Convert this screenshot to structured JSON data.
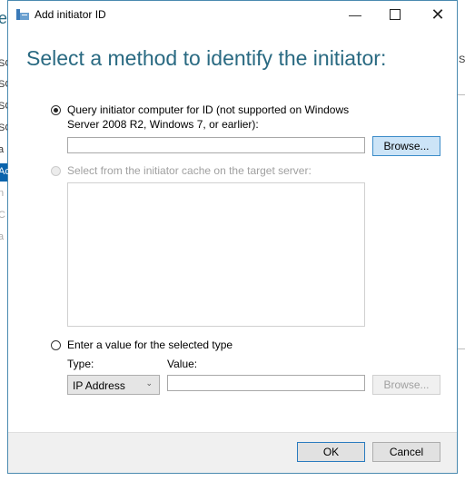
{
  "window": {
    "title": "Add initiator ID",
    "minimize_icon": "minimize-icon",
    "maximize_icon": "maximize-icon",
    "close_icon": "close-icon"
  },
  "heading": "Select a method to identify the initiator:",
  "options": {
    "query": {
      "label_line1": "Query initiator computer for ID (not supported on Windows",
      "label_line2": "Server 2008 R2, Windows 7, or earlier):",
      "selected": true,
      "value": "",
      "browse_label": "Browse..."
    },
    "cache": {
      "label": "Select from the initiator cache on the target server:",
      "enabled": false
    },
    "manual": {
      "label": "Enter a value for the selected type",
      "selected": false,
      "type_label": "Type:",
      "type_value": "IP Address",
      "value_label": "Value:",
      "value": "",
      "browse_label": "Browse..."
    }
  },
  "footer": {
    "ok_label": "OK",
    "cancel_label": "Cancel"
  },
  "background_window": {
    "fragments": [
      "e",
      "SC",
      "SC",
      "SC",
      "SC",
      "a",
      "Ac",
      "n",
      "C",
      "a",
      "Sl"
    ]
  },
  "colors": {
    "heading": "#2a6a82",
    "accent": "#0a64ad"
  }
}
